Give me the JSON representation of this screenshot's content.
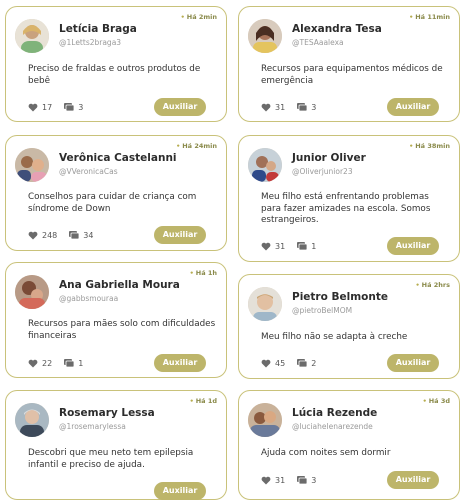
{
  "posts": [
    {
      "name": "Letícia Braga",
      "handle": "@1Letts2braga3",
      "time": "Há 2min",
      "text": "Preciso de fraldas e outros produtos de bebê",
      "likes": "17",
      "comments": "3",
      "button": "Auxiliar"
    },
    {
      "name": "Alexandra Tesa",
      "handle": "@TESAaalexa",
      "time": "Há 11min",
      "text": "Recursos para equipamentos médicos de emergência",
      "likes": "31",
      "comments": "3",
      "button": "Auxiliar"
    },
    {
      "name": "Verônica Castelanni",
      "handle": "@VVeronicaCas",
      "time": "Há 24min",
      "text": "Conselhos para cuidar de criança com síndrome de Down",
      "likes": "248",
      "comments": "34",
      "button": "Auxiliar"
    },
    {
      "name": "Junior Oliver",
      "handle": "@Oliverjunior23",
      "time": "Há 38min",
      "text": "Meu filho está enfrentando problemas para fazer amizades na escola. Somos estrangeiros.",
      "likes": "31",
      "comments": "1",
      "button": "Auxiliar"
    },
    {
      "name": "Ana Gabriella Moura",
      "handle": "@gabbsmouraa",
      "time": "Há 1h",
      "text": "Recursos para mães solo com dificuldades financeiras",
      "likes": "22",
      "comments": "1",
      "button": "Auxiliar"
    },
    {
      "name": "Pietro Belmonte",
      "handle": "@pietroBelMOM",
      "time": "Há 2hrs",
      "text": "Meu filho não se adapta à creche",
      "likes": "45",
      "comments": "2",
      "button": "Auxiliar"
    },
    {
      "name": "Rosemary Lessa",
      "handle": "@1rosemarylessa",
      "time": "Há 1d",
      "text": "Descobri que meu neto tem epilepsia infantil e preciso de ajuda.",
      "likes": "",
      "comments": "",
      "button": "Auxiliar"
    },
    {
      "name": "Lúcia Rezende",
      "handle": "@luciahelenarezende",
      "time": "Há 3d",
      "text": "Ajuda com noites sem dormir",
      "likes": "31",
      "comments": "3",
      "button": "Auxiliar"
    }
  ],
  "colors": {
    "accent": "#bdb56a",
    "border": "#c9c27a",
    "name": "#2c2c2c",
    "muted": "#9a9a9a"
  },
  "icons": {
    "like": "heart-icon",
    "comment": "comment-icon"
  }
}
